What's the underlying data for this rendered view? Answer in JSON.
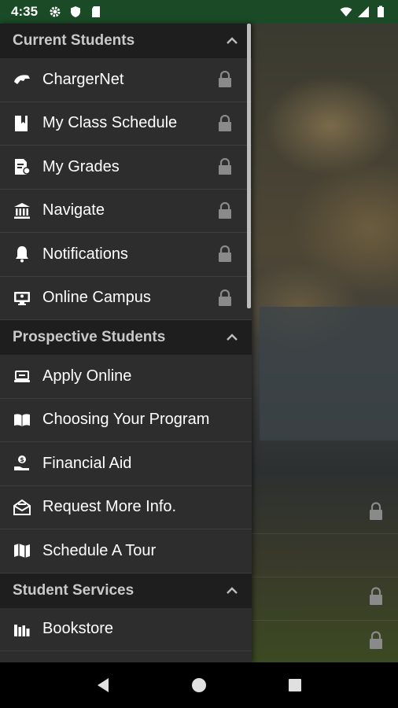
{
  "status_bar": {
    "time": "4:35",
    "left_icons": [
      "gear-icon",
      "shield-icon",
      "sd-card-icon"
    ],
    "right_icons": [
      "wifi-icon",
      "signal-icon",
      "battery-icon"
    ]
  },
  "drawer": {
    "sections": [
      {
        "title": "Current Students",
        "expanded": true,
        "items": [
          {
            "label": "ChargerNet",
            "icon": "charger-logo-icon",
            "locked": true
          },
          {
            "label": "My Class Schedule",
            "icon": "book-icon",
            "locked": true
          },
          {
            "label": "My Grades",
            "icon": "grades-icon",
            "locked": true
          },
          {
            "label": "Navigate",
            "icon": "institution-icon",
            "locked": true
          },
          {
            "label": "Notifications",
            "icon": "bell-icon",
            "locked": true
          },
          {
            "label": "Online Campus",
            "icon": "monitor-icon",
            "locked": true
          }
        ]
      },
      {
        "title": "Prospective Students",
        "expanded": true,
        "items": [
          {
            "label": "Apply Online",
            "icon": "laptop-icon",
            "locked": false
          },
          {
            "label": "Choosing Your Program",
            "icon": "open-book-icon",
            "locked": false
          },
          {
            "label": "Financial Aid",
            "icon": "hand-coin-icon",
            "locked": false
          },
          {
            "label": "Request More Info.",
            "icon": "envelope-icon",
            "locked": false
          },
          {
            "label": "Schedule A Tour",
            "icon": "map-icon",
            "locked": false
          }
        ]
      },
      {
        "title": "Student Services",
        "expanded": true,
        "items": [
          {
            "label": "Bookstore",
            "icon": "books-icon",
            "locked": false
          }
        ]
      }
    ]
  },
  "colors": {
    "status_bar": "#1a4a26",
    "drawer_bg": "#2d2d2d",
    "section_header_bg": "#1e1e1e"
  }
}
